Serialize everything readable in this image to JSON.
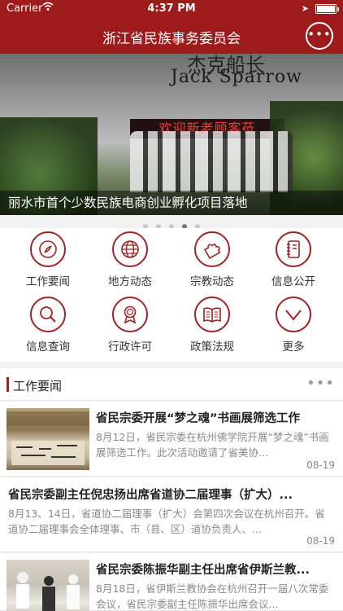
{
  "status": {
    "carrier": "Carrier",
    "time": "4:37 PM",
    "battery_level": 1.0
  },
  "nav": {
    "title": "浙江省民族事务委员会",
    "more": "•••"
  },
  "banner": {
    "caption": "丽水市首个少数民族电商创业孵化项目落地",
    "sign_text": "Jack Sparrow",
    "led_text": "欢迎新老顾客莅",
    "slide_count": 5,
    "active_slide": 4
  },
  "grid": [
    {
      "label": "工作要闻",
      "icon": "compass-icon"
    },
    {
      "label": "地方动态",
      "icon": "globe-icon"
    },
    {
      "label": "宗教动态",
      "icon": "puzzle-icon"
    },
    {
      "label": "信息公开",
      "icon": "notebook-icon"
    },
    {
      "label": "信息查询",
      "icon": "search-icon"
    },
    {
      "label": "行政许可",
      "icon": "award-icon"
    },
    {
      "label": "政策法规",
      "icon": "book-icon"
    },
    {
      "label": "更多",
      "icon": "chevron-down-icon"
    }
  ],
  "section": {
    "title": "工作要闻",
    "more": "•••"
  },
  "news": [
    {
      "title": "省民宗委开展“梦之魂”书画展筛选工作",
      "summary": "8月12日，省民宗委在杭州佛学院开展“梦之魂”书画展筛选工作。此次活动邀请了省美协...",
      "date": "08-19",
      "has_thumb": true
    },
    {
      "title": "省民宗委副主任倪忠扬出席省道协二届理事（扩大）...",
      "summary": "8月13、14日，省道协二届理事（扩大）会第四次会议在杭州召开。省道协二届理事会全体理事、市（县、区）道协负责人、...",
      "date": "08-19",
      "has_thumb": false
    },
    {
      "title": "省民宗委陈振华副主任出席省伊斯兰教...",
      "summary": "8月18日，省伊斯兰教协会在杭州召开一届八次常委会议，省民宗委副主任陈振华出席会议...",
      "date": "",
      "has_thumb": true
    }
  ]
}
